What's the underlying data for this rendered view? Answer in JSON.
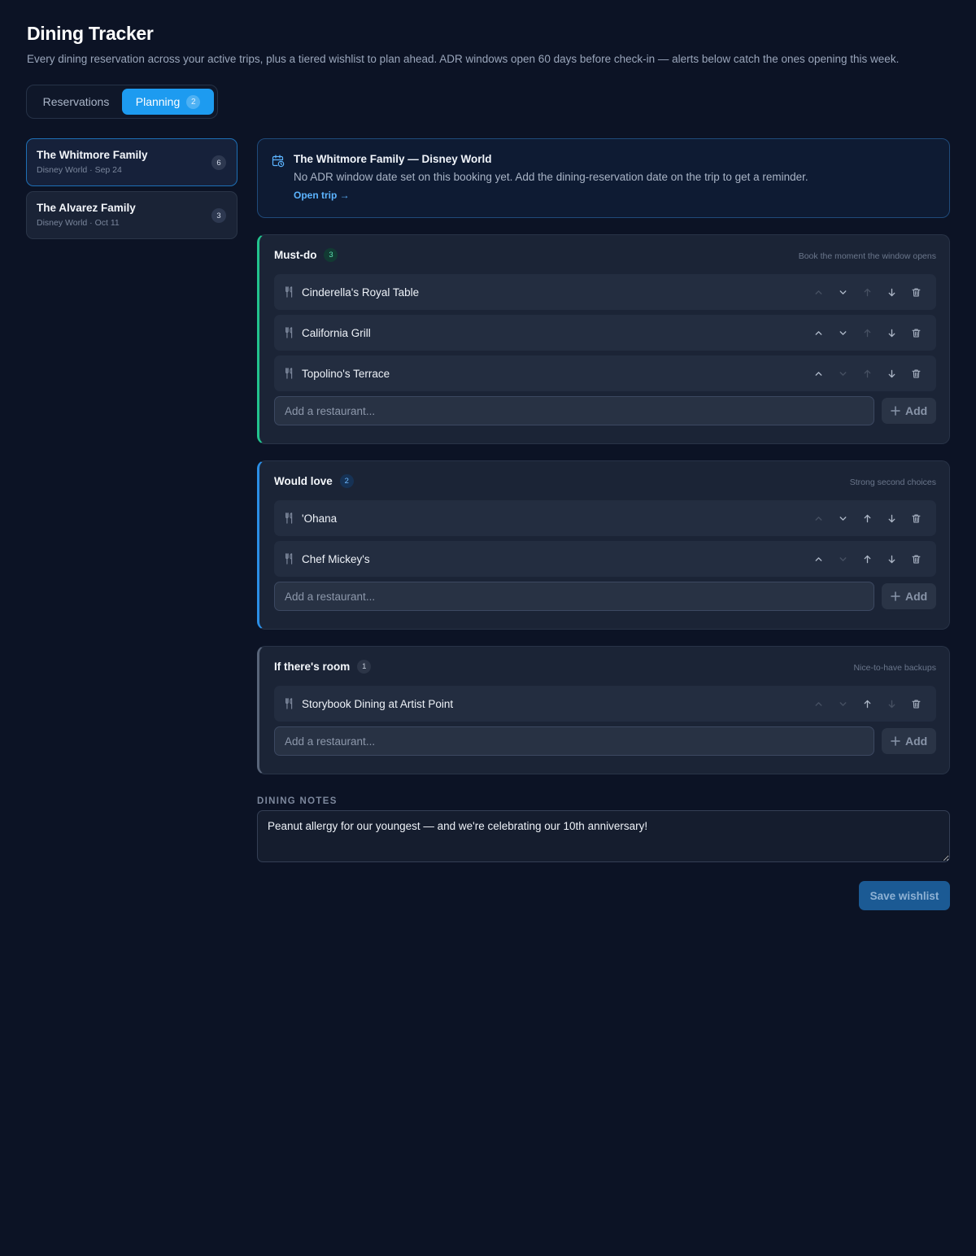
{
  "header": {
    "title": "Dining Tracker",
    "subtitle": "Every dining reservation across your active trips, plus a tiered wishlist to plan ahead. ADR windows open 60 days before check-in — alerts below catch the ones opening this week."
  },
  "tabs": {
    "reservations_label": "Reservations",
    "planning_label": "Planning",
    "planning_count": "2"
  },
  "sidebar": {
    "trips": [
      {
        "name": "The Whitmore Family",
        "meta": "Disney World · Sep 24",
        "count": "6"
      },
      {
        "name": "The Alvarez Family",
        "meta": "Disney World · Oct 11",
        "count": "3"
      }
    ]
  },
  "alert": {
    "title": "The Whitmore Family — Disney World",
    "body": "No ADR window date set on this booking yet. Add the dining-reservation date on the trip to get a reminder.",
    "link": "Open trip →"
  },
  "tiers": {
    "must": {
      "name": "Must-do",
      "count": "3",
      "hint": "Book the moment the window opens",
      "items": [
        "Cinderella's Royal Table",
        "California Grill",
        "Topolino's Terrace"
      ]
    },
    "love": {
      "name": "Would love",
      "count": "2",
      "hint": "Strong second choices",
      "items": [
        "'Ohana",
        "Chef Mickey's"
      ]
    },
    "room": {
      "name": "If there's room",
      "count": "1",
      "hint": "Nice-to-have backups",
      "items": [
        "Storybook Dining at Artist Point"
      ]
    }
  },
  "add": {
    "placeholder": "Add a restaurant...",
    "button_label": "Add"
  },
  "notes": {
    "label": "DINING NOTES",
    "value": "Peanut allergy for our youngest — and we're celebrating our 10th anniversary!"
  },
  "save_label": "Save wishlist",
  "colors": {
    "background": "#0c1325",
    "accent": "#1d9bf0",
    "must_do": "#22c38e",
    "would_love": "#2b8ee6",
    "if_room": "#59657a"
  },
  "icons": {
    "alert": "calendar-clock-icon",
    "item": "utensils-icon",
    "actions": [
      "chevron-up-icon",
      "chevron-down-icon",
      "arrow-up-icon",
      "arrow-down-icon",
      "trash-icon"
    ],
    "add": "plus-icon"
  }
}
